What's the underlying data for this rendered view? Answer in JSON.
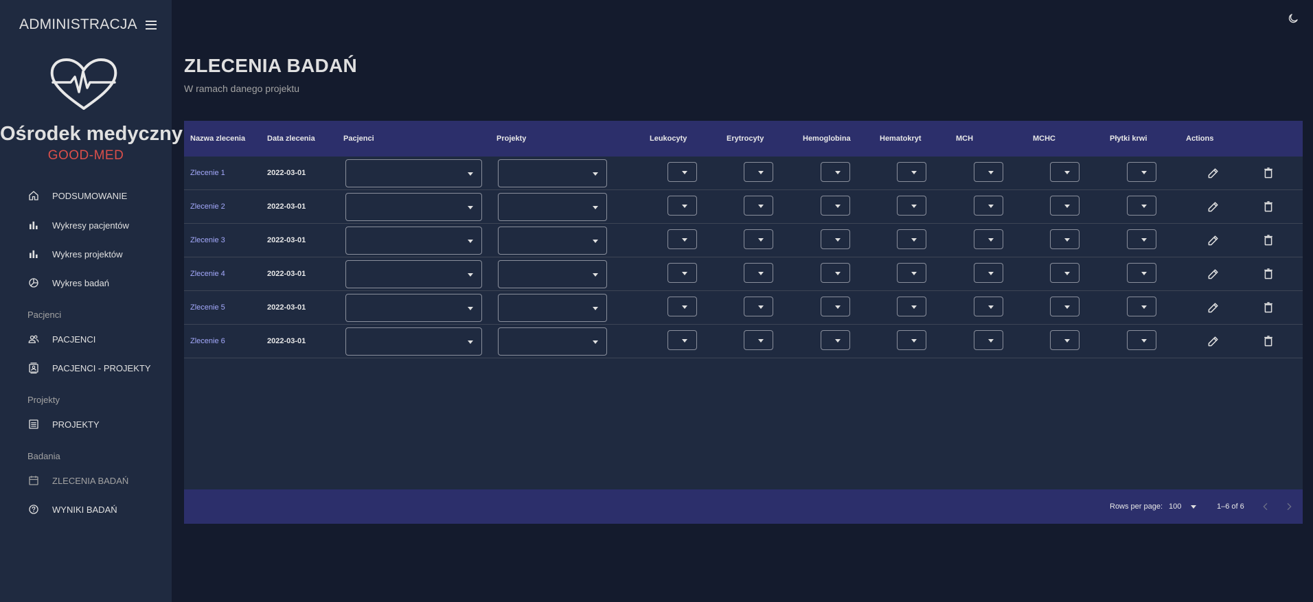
{
  "sidebar": {
    "title": "ADMINISTRACJA",
    "org_name": "Ośrodek medyczny",
    "org_sub": "GOOD-MED",
    "items": [
      {
        "label": "PODSUMOWANIE",
        "icon": "home-icon"
      },
      {
        "label": "Wykresy pacjentów",
        "icon": "bar-chart-icon"
      },
      {
        "label": "Wykres projektów",
        "icon": "bar-chart-icon"
      },
      {
        "label": "Wykres badań",
        "icon": "pie-chart-icon"
      }
    ],
    "sections": {
      "pacjenci": "Pacjenci",
      "projekty": "Projekty",
      "badania": "Badania"
    },
    "pacjenci_items": [
      {
        "label": "PACJENCI",
        "icon": "people-icon"
      },
      {
        "label": "PACJENCI - PROJEKTY",
        "icon": "contact-card-icon"
      }
    ],
    "projekty_items": [
      {
        "label": "PROJEKTY",
        "icon": "list-icon"
      }
    ],
    "badania_items": [
      {
        "label": "ZLECENIA BADAŃ",
        "icon": "calendar-icon",
        "active": true
      },
      {
        "label": "WYNIKI BADAŃ",
        "icon": "help-circle-icon"
      }
    ]
  },
  "header": {
    "title": "ZLECENIA BADAŃ",
    "subtitle": "W ramach danego projektu"
  },
  "table": {
    "columns": [
      "Nazwa zlecenia",
      "Data zlecenia",
      "Pacjenci",
      "Projekty",
      "Leukocyty",
      "Erytrocyty",
      "Hemoglobina",
      "Hematokryt",
      "MCH",
      "MCHC",
      "Płytki krwi",
      "Actions"
    ],
    "rows": [
      {
        "name": "Zlecenie 1",
        "date": "2022-03-01"
      },
      {
        "name": "Zlecenie 2",
        "date": "2022-03-01"
      },
      {
        "name": "Zlecenie 3",
        "date": "2022-03-01"
      },
      {
        "name": "Zlecenie 4",
        "date": "2022-03-01"
      },
      {
        "name": "Zlecenie 5",
        "date": "2022-03-01"
      },
      {
        "name": "Zlecenie 6",
        "date": "2022-03-01"
      }
    ],
    "footer": {
      "rows_per_page_label": "Rows per page:",
      "rows_per_page_value": "100",
      "range": "1–6 of 6"
    }
  },
  "colors": {
    "background": "#141b2d",
    "panel": "#1f2a40",
    "header_bar": "#2c2f6b",
    "accent_red": "#db4f4a",
    "link": "#a4a9fc"
  }
}
